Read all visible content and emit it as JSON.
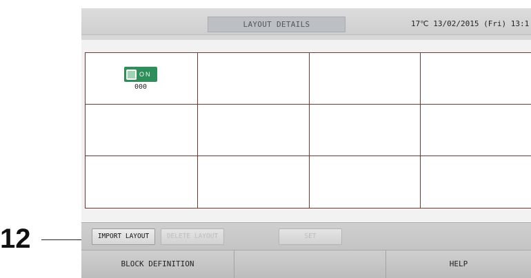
{
  "callout": {
    "number": "12"
  },
  "header": {
    "title": "LAYOUT DETAILS",
    "status": "17℃  13/02/2015 (Fri) 13:1"
  },
  "layout_grid": {
    "rows": 3,
    "cols": 4,
    "units": [
      {
        "row": 1,
        "col": 1,
        "status": "ON",
        "id": "000",
        "color": "#2f8f5a"
      }
    ]
  },
  "toolbar": {
    "import_label": "IMPORT LAYOUT",
    "delete_label": "DELETE LAYOUT",
    "set_label": "SET"
  },
  "footer": {
    "block_definition_label": "BLOCK DEFINITION",
    "middle_label": "",
    "help_label": "HELP"
  },
  "colors": {
    "grid_line": "#6a3a32",
    "unit_on": "#2f8f5a",
    "disabled_text": "#bdbdbd"
  }
}
